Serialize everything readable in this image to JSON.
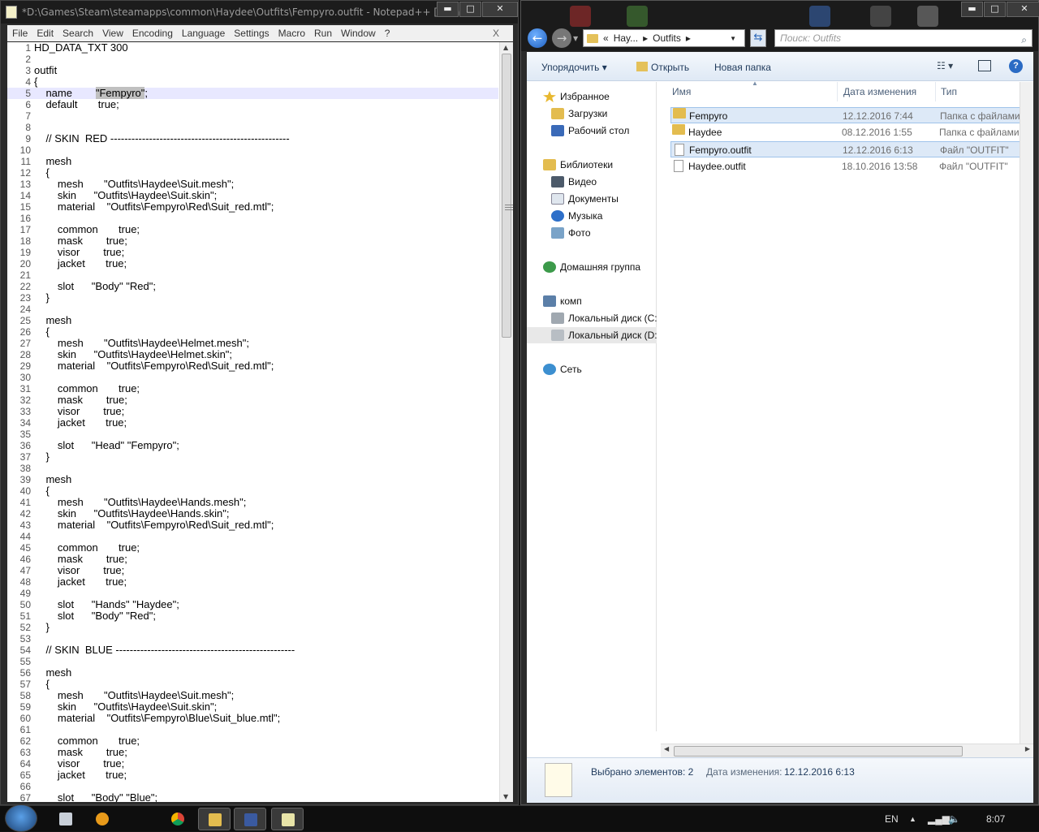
{
  "notepad": {
    "title": "*D:\\Games\\Steam\\steamapps\\common\\Haydee\\Outfits\\Fempyro.outfit - Notepad++ [Admi...",
    "window_buttons": {
      "minimize": "▬",
      "maximize": "□",
      "close": "✕"
    },
    "menu": [
      "File",
      "Edit",
      "Search",
      "View",
      "Encoding",
      "Language",
      "Settings",
      "Macro",
      "Run",
      "Window",
      "?"
    ],
    "menu_close": "X",
    "highlighted_line": 5,
    "lines": [
      "HD_DATA_TXT 300",
      "",
      "outfit",
      "{",
      "    name        \"Fempyro\";",
      "    default       true;",
      "",
      "",
      "    // SKIN  RED ---------------------------------------------------",
      "",
      "    mesh",
      "    {",
      "        mesh       \"Outfits\\Haydee\\Suit.mesh\";",
      "        skin      \"Outfits\\Haydee\\Suit.skin\";",
      "        material    \"Outfits\\Fempyro\\Red\\Suit_red.mtl\";",
      "",
      "        common       true;",
      "        mask        true;",
      "        visor        true;",
      "        jacket       true;",
      "",
      "        slot      \"Body\" \"Red\";",
      "    }",
      "",
      "    mesh",
      "    {",
      "        mesh       \"Outfits\\Haydee\\Helmet.mesh\";",
      "        skin      \"Outfits\\Haydee\\Helmet.skin\";",
      "        material    \"Outfits\\Fempyro\\Red\\Suit_red.mtl\";",
      "",
      "        common       true;",
      "        mask        true;",
      "        visor        true;",
      "        jacket       true;",
      "",
      "        slot      \"Head\" \"Fempyro\";",
      "    }",
      "",
      "    mesh",
      "    {",
      "        mesh       \"Outfits\\Haydee\\Hands.mesh\";",
      "        skin      \"Outfits\\Haydee\\Hands.skin\";",
      "        material    \"Outfits\\Fempyro\\Red\\Suit_red.mtl\";",
      "",
      "        common       true;",
      "        mask        true;",
      "        visor        true;",
      "        jacket       true;",
      "",
      "        slot      \"Hands\" \"Haydee\";",
      "        slot      \"Body\" \"Red\";",
      "    }",
      "",
      "    // SKIN  BLUE ---------------------------------------------------",
      "",
      "    mesh",
      "    {",
      "        mesh       \"Outfits\\Haydee\\Suit.mesh\";",
      "        skin      \"Outfits\\Haydee\\Suit.skin\";",
      "        material    \"Outfits\\Fempyro\\Blue\\Suit_blue.mtl\";",
      "",
      "        common       true;",
      "        mask        true;",
      "        visor        true;",
      "        jacket       true;",
      "",
      "        slot      \"Body\" \"Blue\";"
    ]
  },
  "explorer": {
    "breadcrumb": [
      "«",
      "Hay...",
      "▸",
      "Outfits",
      "▸"
    ],
    "search_placeholder": "Поиск: Outfits",
    "toolbar": {
      "organize": "Упорядочить ▾",
      "open": "Открыть",
      "new_folder": "Новая папка",
      "views": "☷ ▾",
      "help": "?"
    },
    "nav": {
      "favorites": "Избранное",
      "downloads": "Загрузки",
      "desktop": "Рабочий стол",
      "libraries": "Библиотеки",
      "video": "Видео",
      "documents": "Документы",
      "music": "Музыка",
      "photos": "Фото",
      "homegroup": "Домашняя группа",
      "computer": "комп",
      "disk_c": "Локальный диск (C:",
      "disk_d": "Локальный диск (D:",
      "network": "Сеть"
    },
    "columns": {
      "name": "Имя",
      "date": "Дата изменения",
      "type": "Тип"
    },
    "files": [
      {
        "name": "Fempyro",
        "date": "12.12.2016 7:44",
        "type": "Папка с файлами",
        "kind": "folder",
        "selected": true
      },
      {
        "name": "Haydee",
        "date": "08.12.2016 1:55",
        "type": "Папка с файлами",
        "kind": "folder",
        "selected": false
      },
      {
        "name": "Fempyro.outfit",
        "date": "12.12.2016 6:13",
        "type": "Файл \"OUTFIT\"",
        "kind": "file",
        "selected": true
      },
      {
        "name": "Haydee.outfit",
        "date": "18.10.2016 13:58",
        "type": "Файл \"OUTFIT\"",
        "kind": "file",
        "selected": false
      }
    ],
    "details": {
      "count": "Выбрано элементов: 2",
      "date_label": "Дата изменения:",
      "date_value": "12.12.2016 6:13"
    }
  },
  "taskbar": {
    "lang": "EN",
    "time": "8:07"
  },
  "colors": {
    "selection": "#dde9f7",
    "accent": "#2a6bc4",
    "folder": "#e3bc4f"
  }
}
